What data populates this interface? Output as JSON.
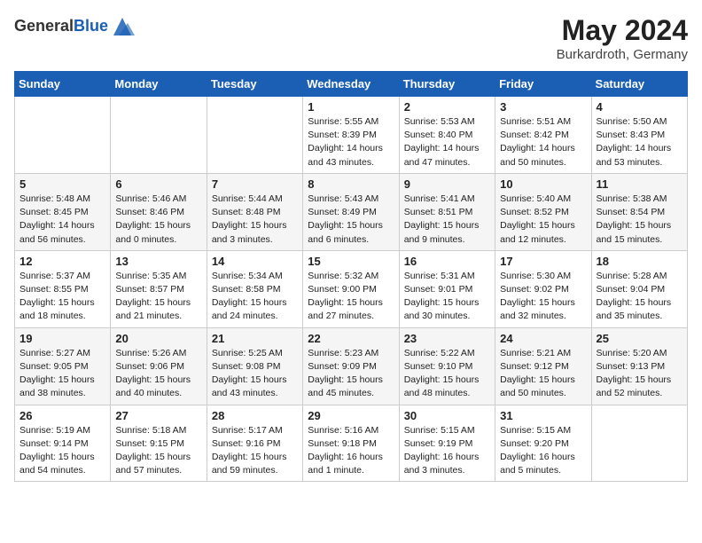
{
  "logo": {
    "general": "General",
    "blue": "Blue"
  },
  "title": {
    "month": "May 2024",
    "location": "Burkardroth, Germany"
  },
  "weekdays": [
    "Sunday",
    "Monday",
    "Tuesday",
    "Wednesday",
    "Thursday",
    "Friday",
    "Saturday"
  ],
  "weeks": [
    [
      {
        "day": "",
        "info": ""
      },
      {
        "day": "",
        "info": ""
      },
      {
        "day": "",
        "info": ""
      },
      {
        "day": "1",
        "info": "Sunrise: 5:55 AM\nSunset: 8:39 PM\nDaylight: 14 hours\nand 43 minutes."
      },
      {
        "day": "2",
        "info": "Sunrise: 5:53 AM\nSunset: 8:40 PM\nDaylight: 14 hours\nand 47 minutes."
      },
      {
        "day": "3",
        "info": "Sunrise: 5:51 AM\nSunset: 8:42 PM\nDaylight: 14 hours\nand 50 minutes."
      },
      {
        "day": "4",
        "info": "Sunrise: 5:50 AM\nSunset: 8:43 PM\nDaylight: 14 hours\nand 53 minutes."
      }
    ],
    [
      {
        "day": "5",
        "info": "Sunrise: 5:48 AM\nSunset: 8:45 PM\nDaylight: 14 hours\nand 56 minutes."
      },
      {
        "day": "6",
        "info": "Sunrise: 5:46 AM\nSunset: 8:46 PM\nDaylight: 15 hours\nand 0 minutes."
      },
      {
        "day": "7",
        "info": "Sunrise: 5:44 AM\nSunset: 8:48 PM\nDaylight: 15 hours\nand 3 minutes."
      },
      {
        "day": "8",
        "info": "Sunrise: 5:43 AM\nSunset: 8:49 PM\nDaylight: 15 hours\nand 6 minutes."
      },
      {
        "day": "9",
        "info": "Sunrise: 5:41 AM\nSunset: 8:51 PM\nDaylight: 15 hours\nand 9 minutes."
      },
      {
        "day": "10",
        "info": "Sunrise: 5:40 AM\nSunset: 8:52 PM\nDaylight: 15 hours\nand 12 minutes."
      },
      {
        "day": "11",
        "info": "Sunrise: 5:38 AM\nSunset: 8:54 PM\nDaylight: 15 hours\nand 15 minutes."
      }
    ],
    [
      {
        "day": "12",
        "info": "Sunrise: 5:37 AM\nSunset: 8:55 PM\nDaylight: 15 hours\nand 18 minutes."
      },
      {
        "day": "13",
        "info": "Sunrise: 5:35 AM\nSunset: 8:57 PM\nDaylight: 15 hours\nand 21 minutes."
      },
      {
        "day": "14",
        "info": "Sunrise: 5:34 AM\nSunset: 8:58 PM\nDaylight: 15 hours\nand 24 minutes."
      },
      {
        "day": "15",
        "info": "Sunrise: 5:32 AM\nSunset: 9:00 PM\nDaylight: 15 hours\nand 27 minutes."
      },
      {
        "day": "16",
        "info": "Sunrise: 5:31 AM\nSunset: 9:01 PM\nDaylight: 15 hours\nand 30 minutes."
      },
      {
        "day": "17",
        "info": "Sunrise: 5:30 AM\nSunset: 9:02 PM\nDaylight: 15 hours\nand 32 minutes."
      },
      {
        "day": "18",
        "info": "Sunrise: 5:28 AM\nSunset: 9:04 PM\nDaylight: 15 hours\nand 35 minutes."
      }
    ],
    [
      {
        "day": "19",
        "info": "Sunrise: 5:27 AM\nSunset: 9:05 PM\nDaylight: 15 hours\nand 38 minutes."
      },
      {
        "day": "20",
        "info": "Sunrise: 5:26 AM\nSunset: 9:06 PM\nDaylight: 15 hours\nand 40 minutes."
      },
      {
        "day": "21",
        "info": "Sunrise: 5:25 AM\nSunset: 9:08 PM\nDaylight: 15 hours\nand 43 minutes."
      },
      {
        "day": "22",
        "info": "Sunrise: 5:23 AM\nSunset: 9:09 PM\nDaylight: 15 hours\nand 45 minutes."
      },
      {
        "day": "23",
        "info": "Sunrise: 5:22 AM\nSunset: 9:10 PM\nDaylight: 15 hours\nand 48 minutes."
      },
      {
        "day": "24",
        "info": "Sunrise: 5:21 AM\nSunset: 9:12 PM\nDaylight: 15 hours\nand 50 minutes."
      },
      {
        "day": "25",
        "info": "Sunrise: 5:20 AM\nSunset: 9:13 PM\nDaylight: 15 hours\nand 52 minutes."
      }
    ],
    [
      {
        "day": "26",
        "info": "Sunrise: 5:19 AM\nSunset: 9:14 PM\nDaylight: 15 hours\nand 54 minutes."
      },
      {
        "day": "27",
        "info": "Sunrise: 5:18 AM\nSunset: 9:15 PM\nDaylight: 15 hours\nand 57 minutes."
      },
      {
        "day": "28",
        "info": "Sunrise: 5:17 AM\nSunset: 9:16 PM\nDaylight: 15 hours\nand 59 minutes."
      },
      {
        "day": "29",
        "info": "Sunrise: 5:16 AM\nSunset: 9:18 PM\nDaylight: 16 hours\nand 1 minute."
      },
      {
        "day": "30",
        "info": "Sunrise: 5:15 AM\nSunset: 9:19 PM\nDaylight: 16 hours\nand 3 minutes."
      },
      {
        "day": "31",
        "info": "Sunrise: 5:15 AM\nSunset: 9:20 PM\nDaylight: 16 hours\nand 5 minutes."
      },
      {
        "day": "",
        "info": ""
      }
    ]
  ]
}
